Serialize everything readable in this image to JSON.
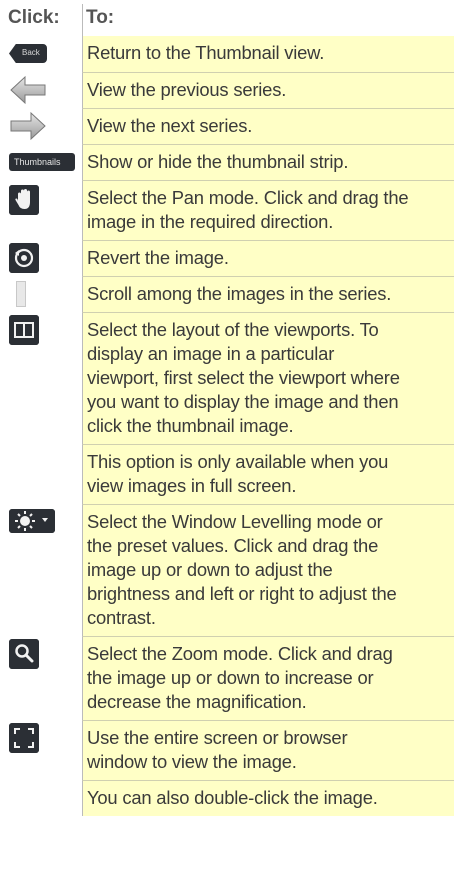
{
  "header": {
    "col_click": "Click:",
    "col_to": "To:"
  },
  "rows": [
    {
      "icon": "back-button-icon",
      "icon_text": "Back",
      "lines": [
        "Return to the Thumbnail view."
      ]
    },
    {
      "icon": "arrow-left-icon",
      "lines": [
        "View the previous series."
      ]
    },
    {
      "icon": "arrow-right-icon",
      "lines": [
        "View the next series."
      ]
    },
    {
      "icon": "thumbnails-button-icon",
      "icon_text": "Thumbnails",
      "lines": [
        "Show or hide the thumbnail strip."
      ]
    },
    {
      "icon": "hand-pan-icon",
      "lines": [
        "Select the Pan mode. Click and drag the",
        "image in the required direction."
      ]
    },
    {
      "icon": "revert-icon",
      "lines": [
        "Revert the image."
      ]
    },
    {
      "icon": "scrollbar-icon",
      "lines": [
        "Scroll among the images in the series."
      ]
    },
    {
      "icon": "layout-icon",
      "lines": [
        "Select the layout of the viewports. To",
        "display an image in a particular",
        "viewport, first select the viewport where",
        "you want to display the image and then",
        "click the thumbnail image."
      ]
    },
    {
      "icon": "",
      "lines": [
        "This option is only available when you",
        "view images in full screen."
      ]
    },
    {
      "icon": "window-levelling-icon",
      "lines": [
        "Select the Window Levelling mode or",
        "the preset values. Click and drag the",
        "image up or down to adjust the",
        "brightness and left or right to adjust the",
        "contrast."
      ]
    },
    {
      "icon": "zoom-icon",
      "lines": [
        "Select the Zoom mode. Click and drag",
        "the image up or down to increase or",
        "decrease the magnification."
      ]
    },
    {
      "icon": "fullscreen-icon",
      "lines": [
        "Use the entire screen or browser",
        "window to view the image."
      ]
    },
    {
      "icon": "",
      "lines": [
        "You can also double-click the image."
      ]
    }
  ]
}
